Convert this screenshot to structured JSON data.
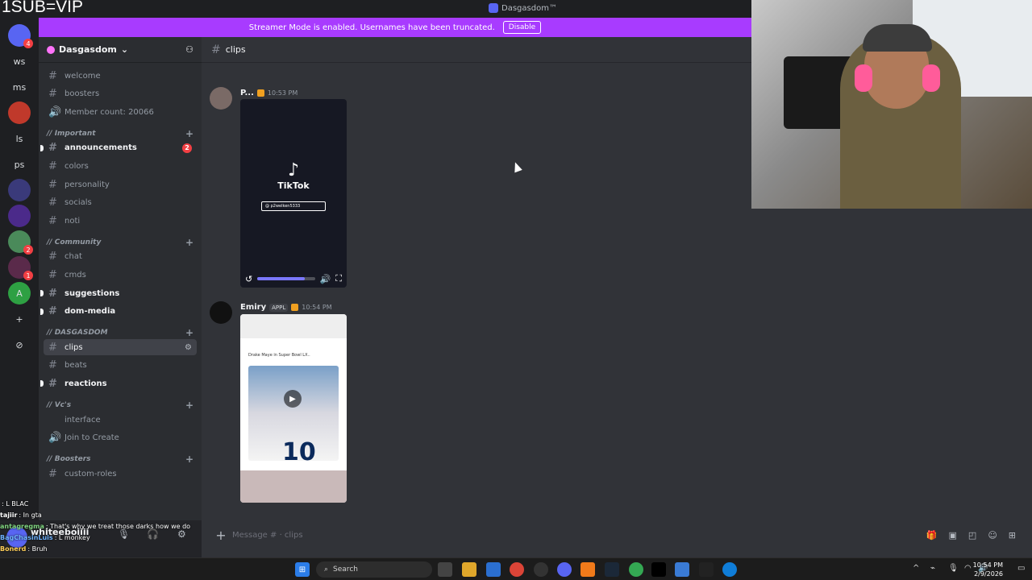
{
  "overlay": {
    "sub_text": "1SUB=VIP"
  },
  "window": {
    "title": "Dasgasdom™"
  },
  "banner": {
    "text": "Streamer Mode is enabled. Usernames have been truncated.",
    "button": "Disable"
  },
  "rail": {
    "items": [
      {
        "label": "",
        "icon": "discord-home-icon",
        "badge": "4"
      },
      {
        "label": "ws"
      },
      {
        "label": "ms"
      },
      {
        "label": "",
        "icon": "server-avatar-icon"
      },
      {
        "label": "ls"
      },
      {
        "label": "ps"
      },
      {
        "label": "",
        "icon": "server-avatar-icon"
      },
      {
        "label": "",
        "icon": "server-avatar-icon"
      },
      {
        "label": "",
        "icon": "server-avatar-icon",
        "badge": "2"
      },
      {
        "label": "",
        "icon": "server-avatar-icon",
        "badge": "1"
      },
      {
        "label": "A",
        "icon": "server-avatar-icon"
      },
      {
        "label": "+",
        "icon": "add-server-icon"
      },
      {
        "label": "⊘",
        "icon": "explore-icon"
      }
    ]
  },
  "server": {
    "name": "Dasgasdom"
  },
  "channels": {
    "items": [
      {
        "type": "channel",
        "name": "welcome"
      },
      {
        "type": "channel",
        "name": "boosters"
      },
      {
        "type": "voice",
        "name": "Member count: 20066"
      },
      {
        "type": "category",
        "name": "// Important"
      },
      {
        "type": "channel",
        "name": "announcements",
        "unread": true,
        "count": "2"
      },
      {
        "type": "channel",
        "name": "colors"
      },
      {
        "type": "channel",
        "name": "personality"
      },
      {
        "type": "channel",
        "name": "socials"
      },
      {
        "type": "channel",
        "name": "noti"
      },
      {
        "type": "category",
        "name": "// Community"
      },
      {
        "type": "channel",
        "name": "chat"
      },
      {
        "type": "channel",
        "name": "cmds"
      },
      {
        "type": "channel",
        "name": "suggestions",
        "unread": true
      },
      {
        "type": "channel",
        "name": "dom-media",
        "unread": true
      },
      {
        "type": "category",
        "name": "// DASGASDOM"
      },
      {
        "type": "channel",
        "name": "clips",
        "active": true
      },
      {
        "type": "channel",
        "name": "beats"
      },
      {
        "type": "channel",
        "name": "reactions",
        "unread": true
      },
      {
        "type": "category",
        "name": "// Vc's"
      },
      {
        "type": "voice-plain",
        "name": "interface"
      },
      {
        "type": "voice",
        "name": "Join to Create"
      },
      {
        "type": "category",
        "name": "// Boosters"
      },
      {
        "type": "channel",
        "name": "custom-roles"
      }
    ]
  },
  "user": {
    "name": "whiteeboiiii"
  },
  "stream_chat": [
    {
      "nick": "",
      "text": ": L BLAC"
    },
    {
      "nick": "tajiir",
      "text": ": In gta"
    },
    {
      "nick": "antagregma",
      "text": ": That's why we treat those darks how we do"
    },
    {
      "nick": "BagChasinLuis",
      "text": ": L monkey"
    },
    {
      "nick": "Bonerd",
      "text": ": Bruh"
    }
  ],
  "main": {
    "channel": "clips",
    "composer_placeholder": "Message # · clips",
    "messages": [
      {
        "author": "P...",
        "time": "10:53 PM",
        "video": {
          "brand": "TikTok",
          "search": "@ p2welken5333",
          "progress": 0.82
        }
      },
      {
        "author": "Emiry",
        "tag": "APPL",
        "time": "10:54 PM",
        "image": {
          "caption": "Drake Maye in Super Bowl LX..",
          "jersey": "10"
        }
      }
    ]
  },
  "taskbar": {
    "search": "Search",
    "time": "10:54 PM",
    "date": "2/9/2026"
  },
  "colors": {
    "banner": "#a83bff",
    "accent": "#5865f2",
    "unread_badge": "#f23f43"
  }
}
